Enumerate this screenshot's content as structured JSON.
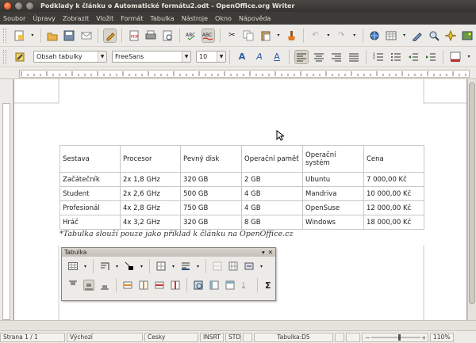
{
  "window": {
    "title": "Podklady k článku o Automatické formátu2.odt - OpenOffice.org Writer"
  },
  "menu": [
    "Soubor",
    "Úpravy",
    "Zobrazit",
    "Vložit",
    "Formát",
    "Tabulka",
    "Nástroje",
    "Okno",
    "Nápověda"
  ],
  "format_toolbar": {
    "paragraph_style": "Obsah tabulky",
    "font_name": "FreeSans",
    "font_size": "10"
  },
  "document": {
    "table": {
      "headers": [
        "Sestava",
        "Procesor",
        "Pevný disk",
        "Operační paměť",
        "Operační systém",
        "Cena"
      ],
      "rows": [
        [
          "Začátečník",
          "2x 1,8 GHz",
          "320 GB",
          "2 GB",
          "Ubuntu",
          "7 000,00 Kč"
        ],
        [
          "Student",
          "2x 2,6 GHz",
          "500 GB",
          "4 GB",
          "Mandriva",
          "10 000,00 Kč"
        ],
        [
          "Profesionál",
          "4x 2,8 GHz",
          "750 GB",
          "4 GB",
          "OpenSuse",
          "12 000,00 Kč"
        ],
        [
          "Hráč",
          "4x 3,2 GHz",
          "320 GB",
          "8 GB",
          "Windows",
          "18 000,00 Kč"
        ]
      ]
    },
    "caption": "*Tabulka slouží pouze jako příklad k článku na OpenOffice.cz"
  },
  "floating_toolbar": {
    "title": "Tabulka",
    "sum_symbol": "Σ"
  },
  "statusbar": {
    "page": "Strana 1 / 1",
    "style": "Výchozí",
    "language": "Česky",
    "insert_mode": "INSRT",
    "selection_mode": "STD",
    "table_cell": "Tabulka:D5",
    "zoom": "110%"
  },
  "colors": {
    "titlebar": "#3c3b37",
    "accent": "#f07746"
  }
}
